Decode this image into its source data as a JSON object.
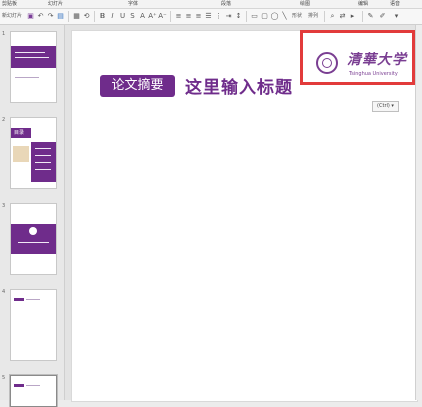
{
  "ribbon": {
    "groups": [
      "剪贴板",
      "幻灯片",
      "字体",
      "段落",
      "绘图",
      "编辑",
      "语音"
    ]
  },
  "toolbar": {
    "new_slide_label": "新幻灯片",
    "shapes_label": "形状",
    "tools_label": "排列"
  },
  "thumbnails": {
    "numbers": [
      "1",
      "2",
      "3",
      "4",
      "5"
    ],
    "slide2_header": "目录"
  },
  "slide": {
    "badge_text": "论文摘要",
    "title": "这里输入标题",
    "logo_cn": "清華大学",
    "logo_en": "Tsinghua University",
    "paste_options": "(Ctrl) ▾"
  },
  "colors": {
    "accent": "#6f2c8b",
    "highlight_border": "#e23b3b"
  }
}
